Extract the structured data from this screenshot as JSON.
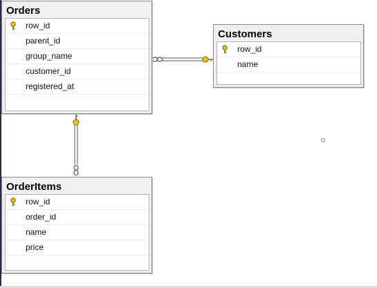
{
  "tables": {
    "orders": {
      "title": "Orders",
      "columns": [
        {
          "name": "row_id",
          "primary_key": true
        },
        {
          "name": "parent_id",
          "primary_key": false
        },
        {
          "name": "group_name",
          "primary_key": false
        },
        {
          "name": "customer_id",
          "primary_key": false
        },
        {
          "name": "registered_at",
          "primary_key": false
        }
      ]
    },
    "customers": {
      "title": "Customers",
      "columns": [
        {
          "name": "row_id",
          "primary_key": true
        },
        {
          "name": "name",
          "primary_key": false
        }
      ]
    },
    "orderitems": {
      "title": "OrderItems",
      "columns": [
        {
          "name": "row_id",
          "primary_key": true
        },
        {
          "name": "order_id",
          "primary_key": false
        },
        {
          "name": "name",
          "primary_key": false
        },
        {
          "name": "price",
          "primary_key": false
        }
      ]
    }
  },
  "relationships": [
    {
      "from": "orders",
      "to": "customers",
      "many_side": "orders",
      "one_side": "customers"
    },
    {
      "from": "orders",
      "to": "orderitems",
      "many_side": "orderitems",
      "one_side": "orders"
    }
  ],
  "colors": {
    "key_fill": "#e8c21e",
    "key_stroke": "#7a5d00",
    "line": "#555555"
  }
}
